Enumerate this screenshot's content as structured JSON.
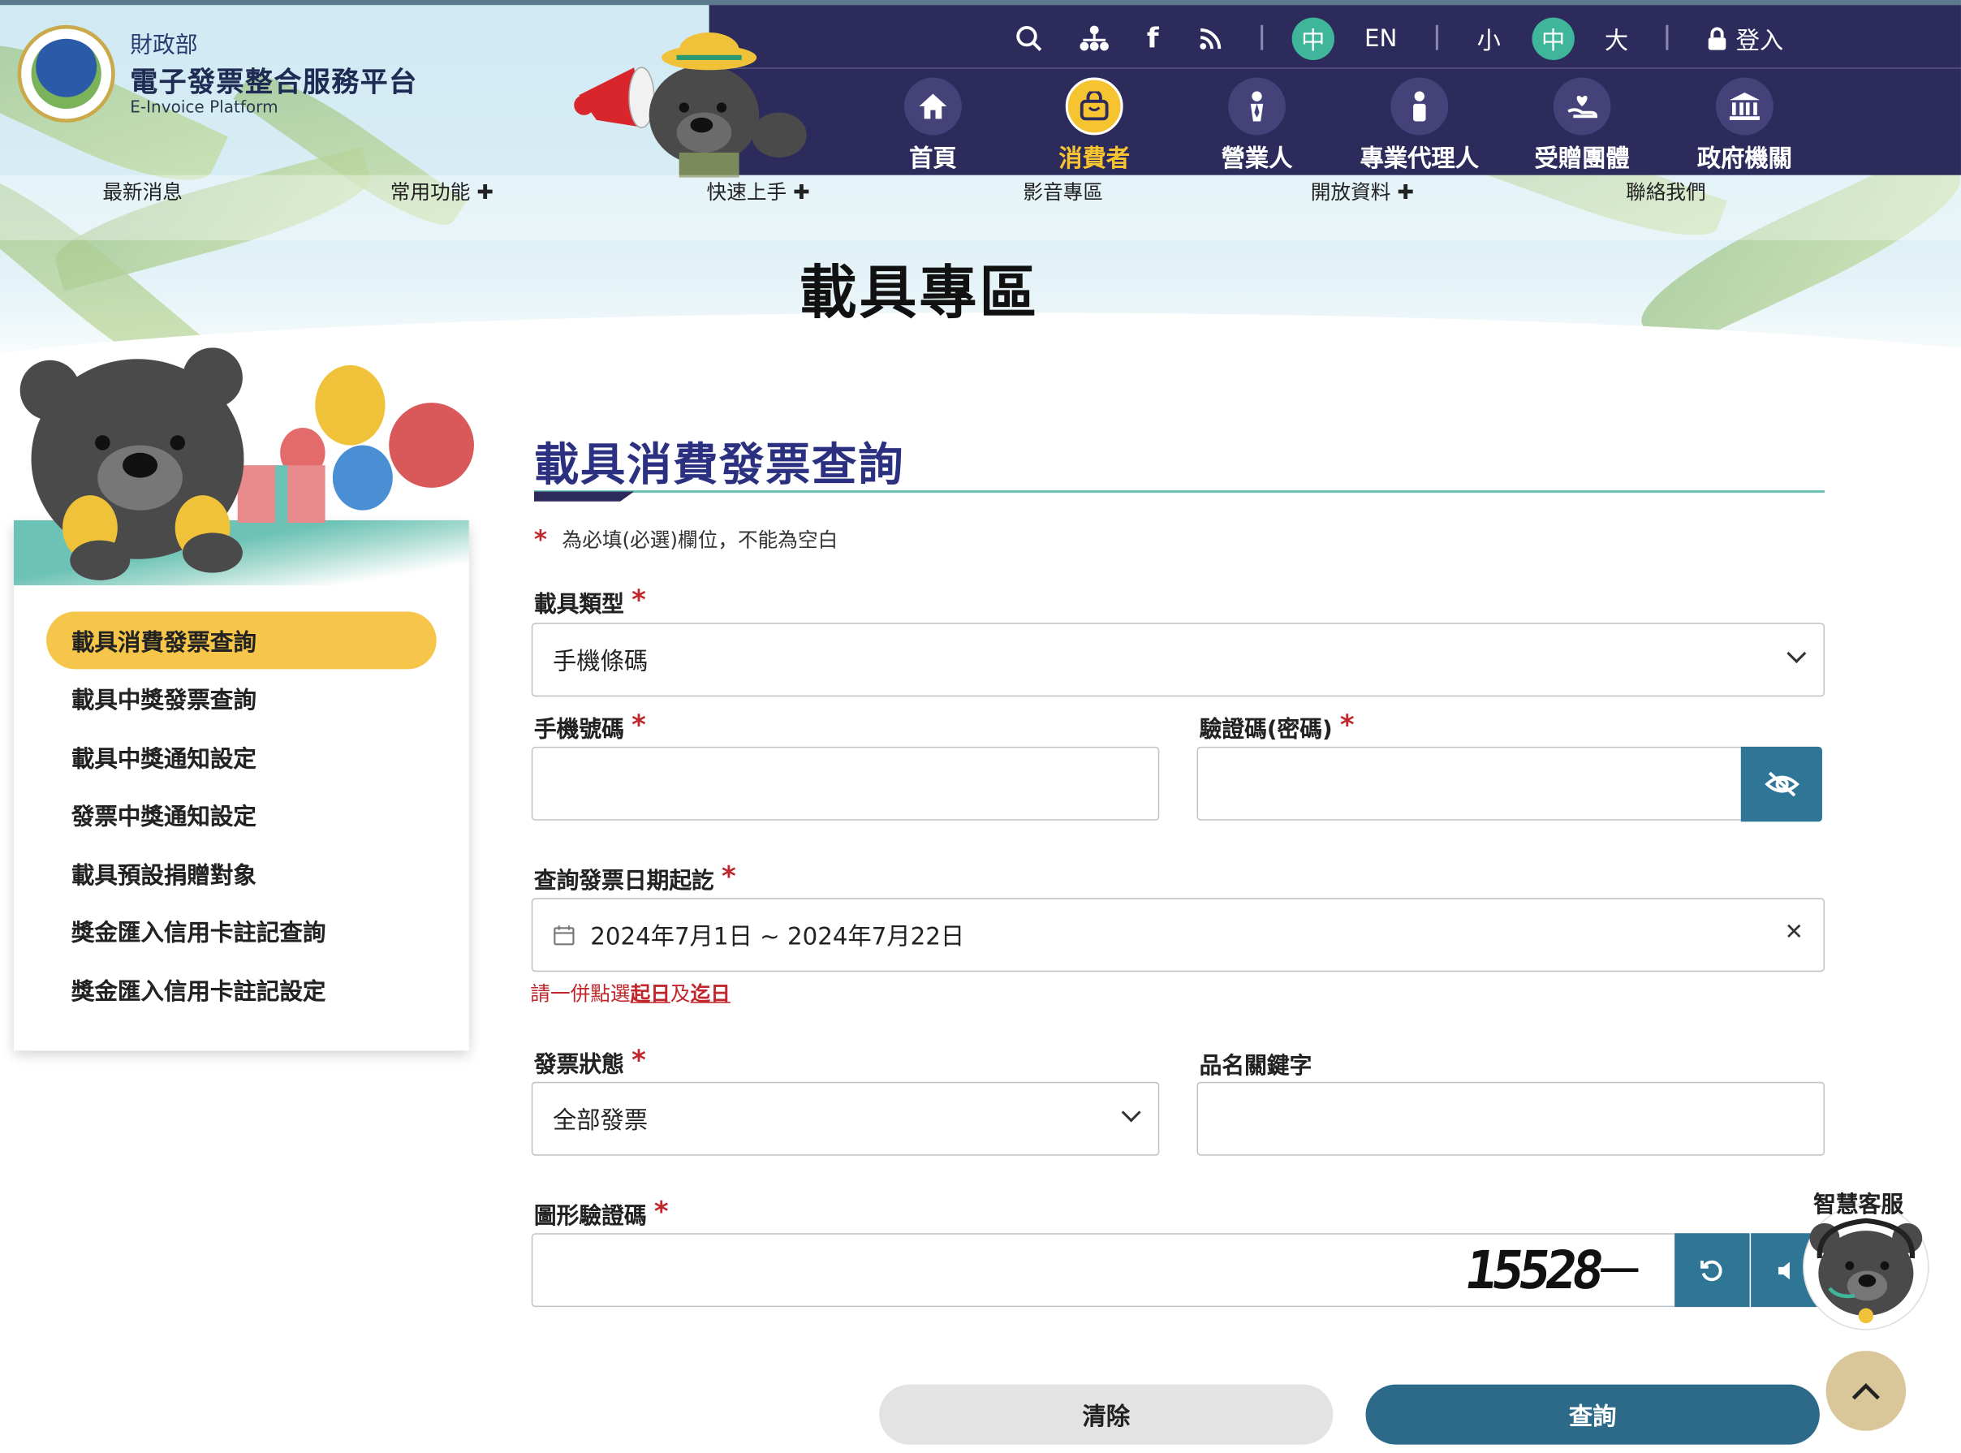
{
  "header": {
    "ministry": "財政部",
    "platform_name": "電子發票整合服務平台",
    "platform_name_en": "E-Invoice Platform",
    "util": {
      "lang_zh": "中",
      "lang_en": "EN",
      "font_small": "小",
      "font_medium": "中",
      "font_large": "大",
      "login": "登入"
    },
    "role_nav": [
      {
        "label": "首頁",
        "icon": "home-icon"
      },
      {
        "label": "消費者",
        "icon": "shopping-bag-icon",
        "active": true
      },
      {
        "label": "營業人",
        "icon": "businessman-icon"
      },
      {
        "label": "專業代理人",
        "icon": "agent-icon"
      },
      {
        "label": "受贈團體",
        "icon": "donation-heart-icon"
      },
      {
        "label": "政府機關",
        "icon": "government-building-icon"
      }
    ],
    "main_nav": [
      {
        "label": "最新消息"
      },
      {
        "label": "常用功能"
      },
      {
        "label": "快速上手"
      },
      {
        "label": "影音專區"
      },
      {
        "label": "開放資料"
      },
      {
        "label": "聯絡我們"
      }
    ]
  },
  "page_title": "載具專區",
  "sidebar": {
    "items": [
      {
        "label": "載具消費發票查詢",
        "active": true
      },
      {
        "label": "載具中獎發票查詢"
      },
      {
        "label": "載具中獎通知設定"
      },
      {
        "label": "發票中獎通知設定"
      },
      {
        "label": "載具預設捐贈對象"
      },
      {
        "label": "獎金匯入信用卡註記查詢"
      },
      {
        "label": "獎金匯入信用卡註記設定"
      }
    ]
  },
  "form": {
    "title": "載具消費發票查詢",
    "required_star": "*",
    "required_note": "為必填(必選)欄位，不能為空白",
    "carrier_type_label": "載具類型",
    "carrier_type_value": "手機條碼",
    "phone_label": "手機號碼",
    "phone_value": "",
    "password_label": "驗證碼(密碼)",
    "password_value": "",
    "date_label": "查詢發票日期起訖",
    "date_value": "2024年7月1日 ~ 2024年7月22日",
    "date_hint_prefix": "請一併點選",
    "date_hint_start": "起日",
    "date_hint_and": "及",
    "date_hint_end": "迄日",
    "status_label": "發票狀態",
    "status_value": "全部發票",
    "keyword_label": "品名關鍵字",
    "keyword_value": "",
    "captcha_label": "圖形驗證碼",
    "captcha_value": "",
    "captcha_image_text": "15528",
    "clear_button": "清除",
    "query_button": "查詢"
  },
  "customer_service": {
    "label": "智慧客服"
  },
  "colors": {
    "nav_bg": "#2d2a5c",
    "accent_yellow": "#f5c430",
    "teal": "#2e7596",
    "green_badge": "#3fb59a",
    "required_red": "#c0272d",
    "title_navy": "#2b3180"
  }
}
